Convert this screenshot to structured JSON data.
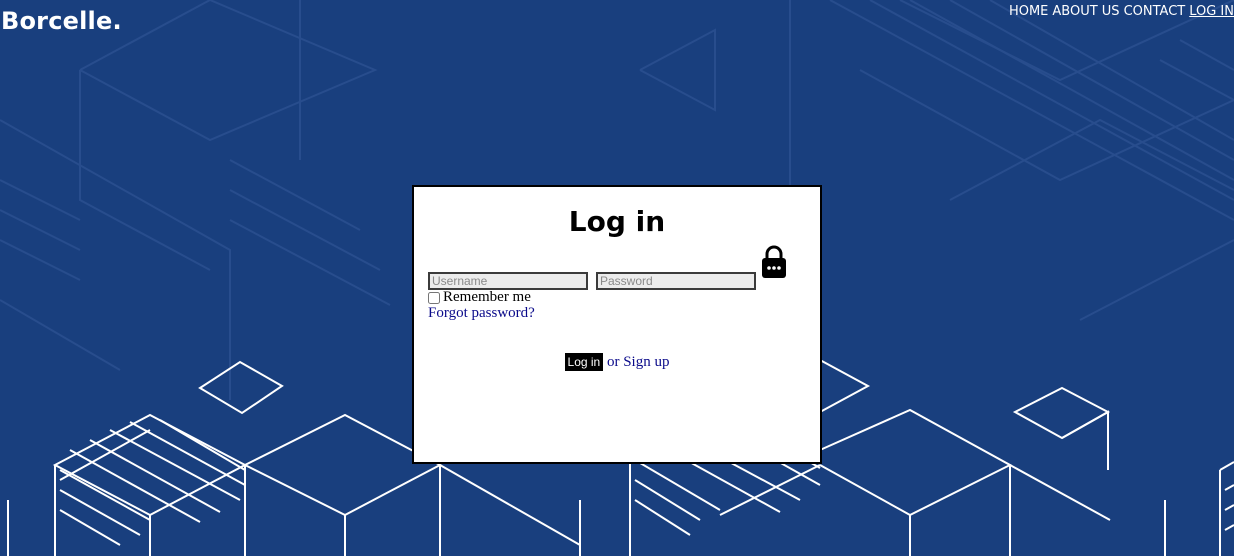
{
  "brand": "Borcelle.",
  "nav": {
    "items": [
      {
        "label": "HOME"
      },
      {
        "label": "ABOUT US"
      },
      {
        "label": "CONTACT"
      },
      {
        "label": "LOG IN",
        "active": true
      }
    ]
  },
  "login": {
    "title": "Log in",
    "icon": "lock-icon",
    "username_placeholder": "Username",
    "password_placeholder": "Password",
    "remember_label": "Remember me",
    "remember_checked": false,
    "forgot_link": "Forgot password?",
    "submit_label": "Log in",
    "or_text": "or",
    "signup_link": "Sign up"
  },
  "colors": {
    "background": "#193f7e",
    "card": "#ffffff",
    "link": "#0a0a8a",
    "button": "#000000"
  }
}
